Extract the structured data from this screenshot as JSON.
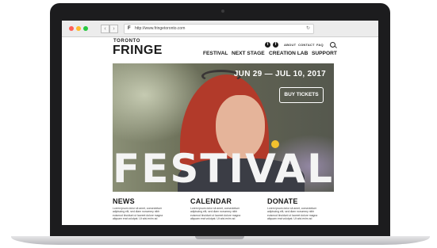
{
  "browser": {
    "url": "http://www.fringetoronto.com",
    "back_icon": "chevron-left-icon",
    "forward_icon": "chevron-right-icon",
    "reload_icon": "reload-icon"
  },
  "site": {
    "logo_top": "TORONTO",
    "logo_main": "FRINGE",
    "utility_nav": [
      "ABOUT",
      "CONTACT",
      "FAQ"
    ],
    "social": [
      "twitter-icon",
      "facebook-icon"
    ],
    "main_nav": [
      "FESTIVAL",
      "NEXT STAGE",
      "CREATION LAB",
      "SUPPORT"
    ]
  },
  "hero": {
    "dates": "JUN 29 — JUL 10, 2017",
    "cta": "BUY TICKETS",
    "title": "FESTIVAL"
  },
  "columns": [
    {
      "title": "NEWS",
      "text": "Lorem ipsum dolor sit amet, consectetuer adipiscing elit, sed diam nonummy nibh euismod tincidunt ut laoreet dolore magna aliquam erat volutpat. Ut wisi enim ad"
    },
    {
      "title": "CALENDAR",
      "text": "Lorem ipsum dolor sit amet, consectetuer adipiscing elit, sed diam nonummy nibh euismod tincidunt ut laoreet dolore magna aliquam erat volutpat. Ut wisi enim ad"
    },
    {
      "title": "DONATE",
      "text": "Lorem ipsum dolor sit amet, consectetuer adipiscing elit, sed diam nonummy nibh euismod tincidunt ut laoreet dolore magna aliquam erat volutpat. Ut wisi enim ad"
    }
  ],
  "colors": {
    "laptop_bezel": "#1c1c1e",
    "text_dark": "#1a1a1a",
    "hero_text": "#ffffff"
  }
}
